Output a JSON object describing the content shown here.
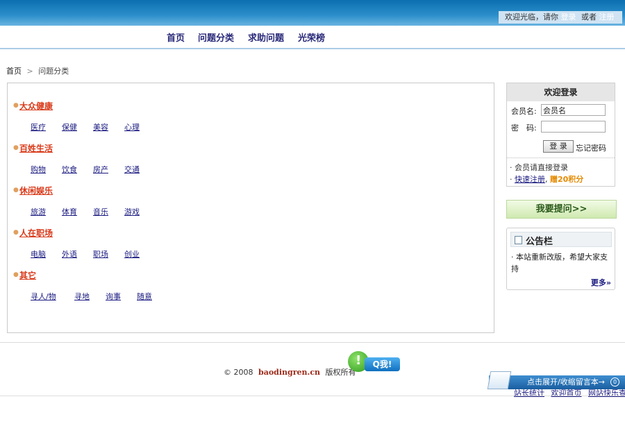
{
  "header": {
    "welcome_text": "欢迎光临，请你",
    "login_link": "登录",
    "or_text": "或者",
    "register_link": "注册"
  },
  "nav": [
    "首页",
    "问题分类",
    "求助问题",
    "光荣榜"
  ],
  "breadcrumb": {
    "home": "首页",
    "separator": ">",
    "current": "问题分类"
  },
  "categories": [
    {
      "title": "大众健康",
      "items": [
        "医疗",
        "保健",
        "美容",
        "心理"
      ]
    },
    {
      "title": "百姓生活",
      "items": [
        "购物",
        "饮食",
        "房产",
        "交通"
      ]
    },
    {
      "title": "休闲娱乐",
      "items": [
        "旅游",
        "体育",
        "音乐",
        "游戏"
      ]
    },
    {
      "title": "人在职场",
      "items": [
        "电脑",
        "外语",
        "职场",
        "创业"
      ]
    },
    {
      "title": "其它",
      "items": [
        "寻人/物",
        "寻地",
        "询事",
        "随意"
      ]
    }
  ],
  "login": {
    "title": "欢迎登录",
    "username_label": "会员名:",
    "username_value": "会员名",
    "password_label": "密　码:",
    "login_button": "登 录",
    "forgot": "忘记密码",
    "note1": "会员请直接登录",
    "quick_register": "快速注册",
    "bonus": "赠20积分"
  },
  "ask_button": "我要提问>>",
  "notice": {
    "title": "公告栏",
    "text": "本站重新改版，希望大家支持",
    "more": "更多»"
  },
  "footer": {
    "copyright_prefix": "© 2008",
    "domain": "baodingren.cn",
    "rights": "版权所有",
    "qq_label": "Q我!",
    "message_bar": "点击展开/收缩留言本→",
    "message_count": "0",
    "bottom_links": [
      "站长统计",
      "欢迎首页",
      "网站快乐查询"
    ]
  },
  "colors": {
    "topbar": "#0b6fb0",
    "category_title": "#d93a1a",
    "link": "#1a1a80",
    "bonus": "#e48a00"
  }
}
